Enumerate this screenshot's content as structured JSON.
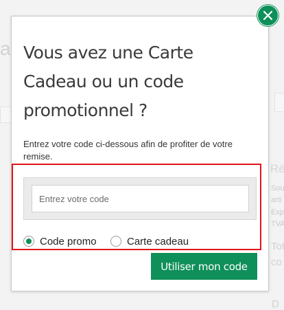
{
  "background": {
    "partial_a": "a",
    "right_heading": "Ré",
    "right_line_1": "Sou",
    "right_line_2": "arti",
    "right_line_3": "Exp",
    "right_line_4": "TVA",
    "right_total": "Tot",
    "right_co": "co",
    "right_d": "D"
  },
  "modal": {
    "title": "Vous avez une Carte Cadeau ou un code promotionnel ?",
    "intro": "Entrez votre code ci-dessous afin de profiter de votre remise.",
    "code_input": {
      "value": "",
      "placeholder": "Entrez votre code"
    },
    "options": [
      {
        "label": "Code promo",
        "checked": true
      },
      {
        "label": "Carte cadeau",
        "checked": false
      }
    ],
    "submit_label": "Utiliser mon code",
    "close_icon": "close-icon"
  },
  "colors": {
    "accent": "#0f8f5a",
    "highlight": "#e0131a"
  }
}
